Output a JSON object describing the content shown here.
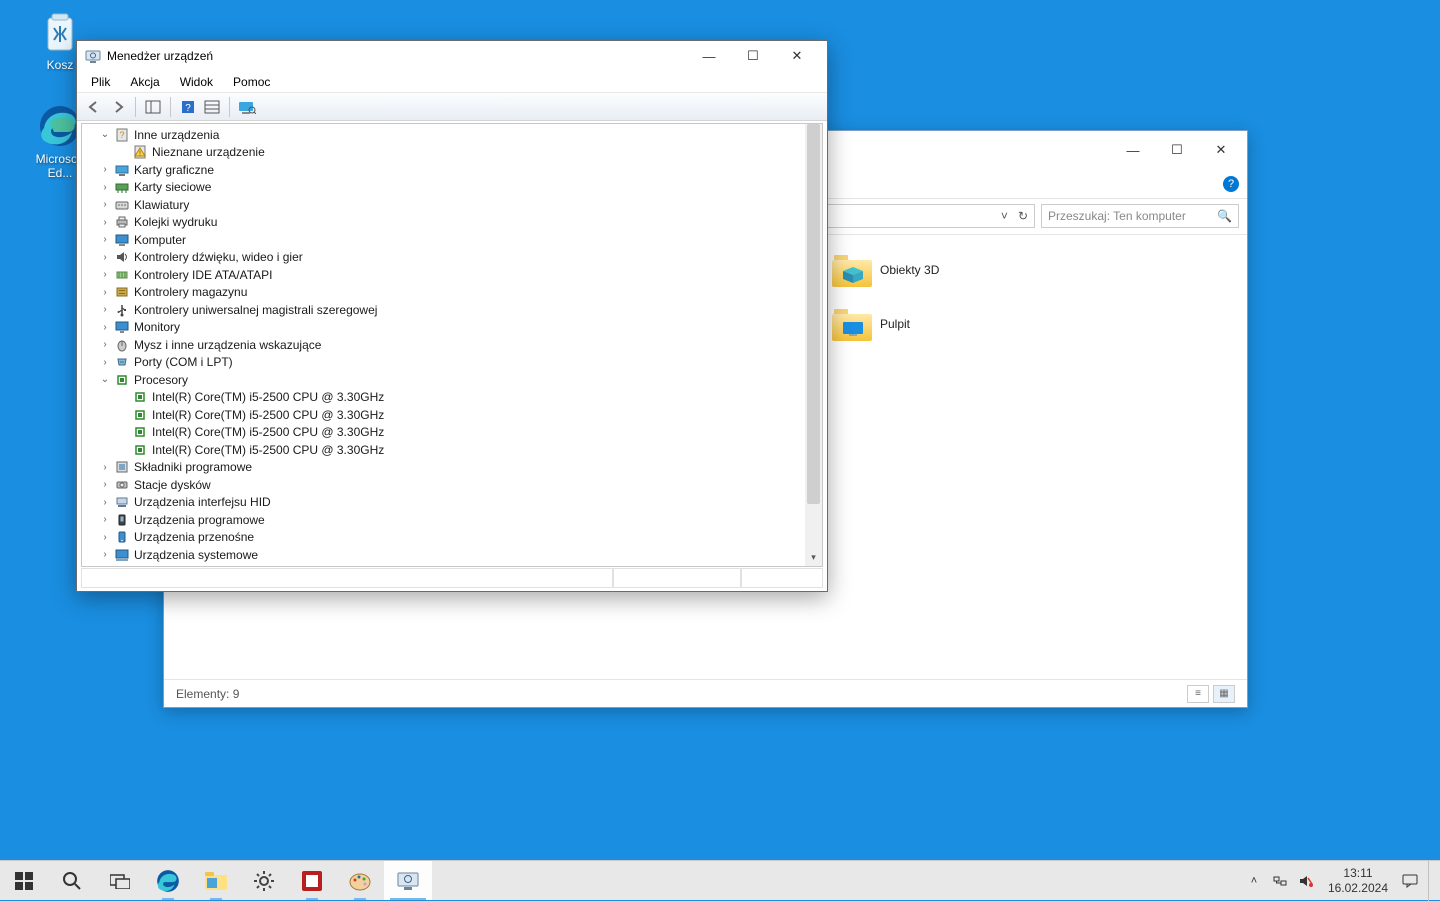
{
  "desktop": {
    "recycle_bin": "Kosz",
    "edge": "Microsoft Ed..."
  },
  "explorer": {
    "search_placeholder": "Przeszukaj: Ten komputer",
    "items_label": "Elementy: 9",
    "items": {
      "obj3d": "Obiekty 3D",
      "pulpit": "Pulpit"
    }
  },
  "devmgr": {
    "title": "Menedżer urządzeń",
    "menu": {
      "file": "Plik",
      "action": "Akcja",
      "view": "Widok",
      "help": "Pomoc"
    },
    "tree": {
      "inne": "Inne urządzenia",
      "nieznane": "Nieznane urządzenie",
      "karty_graficzne": "Karty graficzne",
      "karty_sieciowe": "Karty sieciowe",
      "klawiatury": "Klawiatury",
      "kolejki_wydruku": "Kolejki wydruku",
      "komputer": "Komputer",
      "kontrolery_dzwieku": "Kontrolery dźwięku, wideo i gier",
      "kontrolery_ide": "Kontrolery IDE ATA/ATAPI",
      "kontrolery_magazynu": "Kontrolery magazynu",
      "kontrolery_usb": "Kontrolery uniwersalnej magistrali szeregowej",
      "monitory": "Monitory",
      "mysz": "Mysz i inne urządzenia wskazujące",
      "porty": "Porty (COM i LPT)",
      "procesory": "Procesory",
      "cpu": "Intel(R) Core(TM) i5-2500 CPU @ 3.30GHz",
      "skladniki": "Składniki programowe",
      "stacje_dyskow": "Stacje dysków",
      "hid": "Urządzenia interfejsu HID",
      "urz_prog": "Urządzenia programowe",
      "urz_przen": "Urządzenia przenośne",
      "urz_sys": "Urządzenia systemowe"
    }
  },
  "tray": {
    "time": "13:11",
    "date": "16.02.2024"
  }
}
